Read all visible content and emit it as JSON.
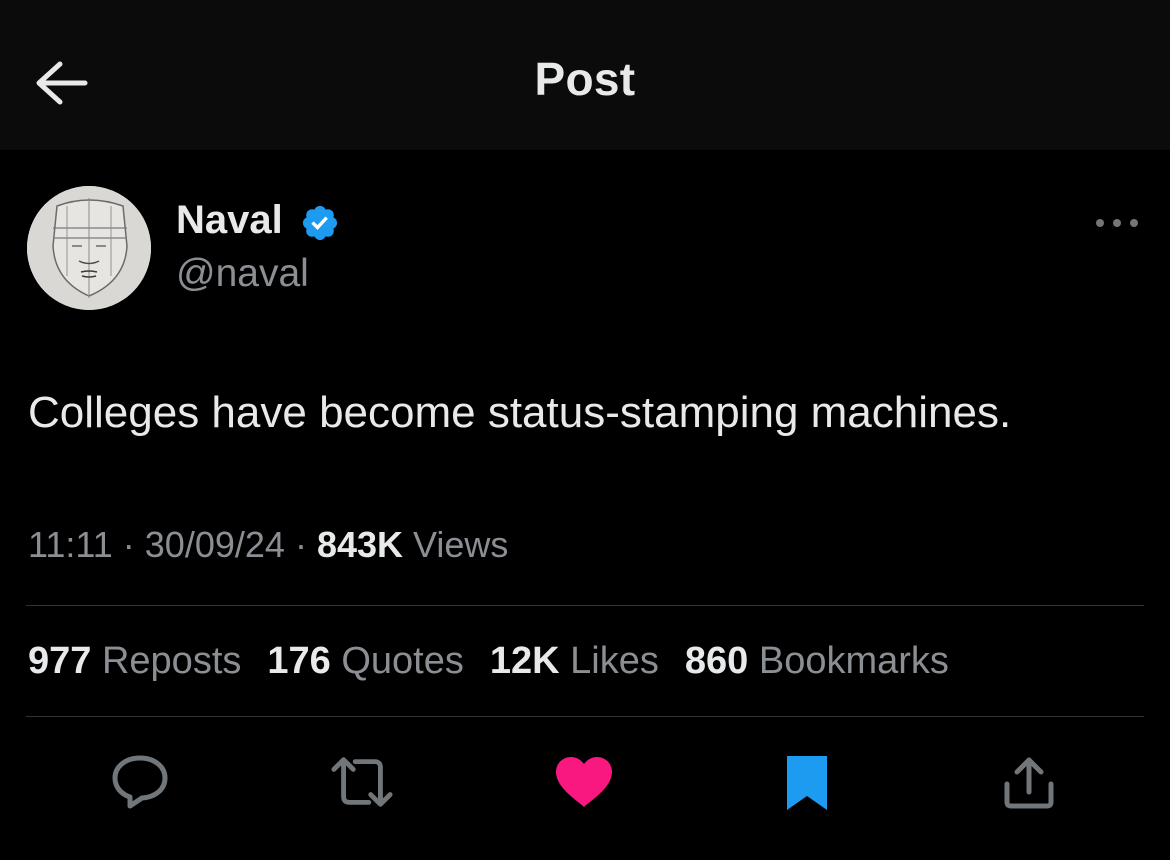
{
  "header": {
    "title": "Post",
    "back_icon": "arrow-left-icon"
  },
  "author": {
    "name": "Naval",
    "handle": "@naval",
    "verified": true,
    "verified_color": "#1d9bf0"
  },
  "post": {
    "text": "Colleges have become status-stamping machines.",
    "time": "11:11",
    "date": "30/09/24",
    "views_count": "843K",
    "views_label": "Views",
    "separator": "·"
  },
  "stats": [
    {
      "count": "977",
      "label": "Reposts"
    },
    {
      "count": "176",
      "label": "Quotes"
    },
    {
      "count": "12K",
      "label": "Likes"
    },
    {
      "count": "860",
      "label": "Bookmarks"
    }
  ],
  "actions": {
    "reply_icon": "reply-icon",
    "repost_icon": "repost-icon",
    "like_icon": "heart-icon",
    "like_active": true,
    "like_color": "#f91880",
    "bookmark_icon": "bookmark-icon",
    "bookmark_active": true,
    "bookmark_color": "#1d9bf0",
    "share_icon": "share-icon"
  }
}
